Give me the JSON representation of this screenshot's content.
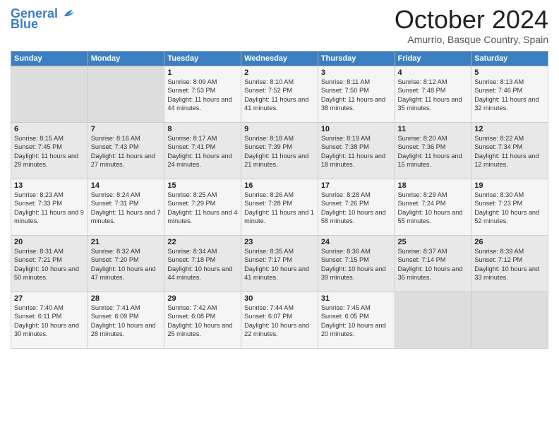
{
  "header": {
    "logo_line1": "General",
    "logo_line2": "Blue",
    "month": "October 2024",
    "location": "Amurrio, Basque Country, Spain"
  },
  "weekdays": [
    "Sunday",
    "Monday",
    "Tuesday",
    "Wednesday",
    "Thursday",
    "Friday",
    "Saturday"
  ],
  "weeks": [
    [
      {
        "day": "",
        "data": ""
      },
      {
        "day": "",
        "data": ""
      },
      {
        "day": "1",
        "data": "Sunrise: 8:09 AM\nSunset: 7:53 PM\nDaylight: 11 hours and 44 minutes."
      },
      {
        "day": "2",
        "data": "Sunrise: 8:10 AM\nSunset: 7:52 PM\nDaylight: 11 hours and 41 minutes."
      },
      {
        "day": "3",
        "data": "Sunrise: 8:11 AM\nSunset: 7:50 PM\nDaylight: 11 hours and 38 minutes."
      },
      {
        "day": "4",
        "data": "Sunrise: 8:12 AM\nSunset: 7:48 PM\nDaylight: 11 hours and 35 minutes."
      },
      {
        "day": "5",
        "data": "Sunrise: 8:13 AM\nSunset: 7:46 PM\nDaylight: 11 hours and 32 minutes."
      }
    ],
    [
      {
        "day": "6",
        "data": "Sunrise: 8:15 AM\nSunset: 7:45 PM\nDaylight: 11 hours and 29 minutes."
      },
      {
        "day": "7",
        "data": "Sunrise: 8:16 AM\nSunset: 7:43 PM\nDaylight: 11 hours and 27 minutes."
      },
      {
        "day": "8",
        "data": "Sunrise: 8:17 AM\nSunset: 7:41 PM\nDaylight: 11 hours and 24 minutes."
      },
      {
        "day": "9",
        "data": "Sunrise: 8:18 AM\nSunset: 7:39 PM\nDaylight: 11 hours and 21 minutes."
      },
      {
        "day": "10",
        "data": "Sunrise: 8:19 AM\nSunset: 7:38 PM\nDaylight: 11 hours and 18 minutes."
      },
      {
        "day": "11",
        "data": "Sunrise: 8:20 AM\nSunset: 7:36 PM\nDaylight: 11 hours and 15 minutes."
      },
      {
        "day": "12",
        "data": "Sunrise: 8:22 AM\nSunset: 7:34 PM\nDaylight: 11 hours and 12 minutes."
      }
    ],
    [
      {
        "day": "13",
        "data": "Sunrise: 8:23 AM\nSunset: 7:33 PM\nDaylight: 11 hours and 9 minutes."
      },
      {
        "day": "14",
        "data": "Sunrise: 8:24 AM\nSunset: 7:31 PM\nDaylight: 11 hours and 7 minutes."
      },
      {
        "day": "15",
        "data": "Sunrise: 8:25 AM\nSunset: 7:29 PM\nDaylight: 11 hours and 4 minutes."
      },
      {
        "day": "16",
        "data": "Sunrise: 8:26 AM\nSunset: 7:28 PM\nDaylight: 11 hours and 1 minute."
      },
      {
        "day": "17",
        "data": "Sunrise: 8:28 AM\nSunset: 7:26 PM\nDaylight: 10 hours and 58 minutes."
      },
      {
        "day": "18",
        "data": "Sunrise: 8:29 AM\nSunset: 7:24 PM\nDaylight: 10 hours and 55 minutes."
      },
      {
        "day": "19",
        "data": "Sunrise: 8:30 AM\nSunset: 7:23 PM\nDaylight: 10 hours and 52 minutes."
      }
    ],
    [
      {
        "day": "20",
        "data": "Sunrise: 8:31 AM\nSunset: 7:21 PM\nDaylight: 10 hours and 50 minutes."
      },
      {
        "day": "21",
        "data": "Sunrise: 8:32 AM\nSunset: 7:20 PM\nDaylight: 10 hours and 47 minutes."
      },
      {
        "day": "22",
        "data": "Sunrise: 8:34 AM\nSunset: 7:18 PM\nDaylight: 10 hours and 44 minutes."
      },
      {
        "day": "23",
        "data": "Sunrise: 8:35 AM\nSunset: 7:17 PM\nDaylight: 10 hours and 41 minutes."
      },
      {
        "day": "24",
        "data": "Sunrise: 8:36 AM\nSunset: 7:15 PM\nDaylight: 10 hours and 39 minutes."
      },
      {
        "day": "25",
        "data": "Sunrise: 8:37 AM\nSunset: 7:14 PM\nDaylight: 10 hours and 36 minutes."
      },
      {
        "day": "26",
        "data": "Sunrise: 8:39 AM\nSunset: 7:12 PM\nDaylight: 10 hours and 33 minutes."
      }
    ],
    [
      {
        "day": "27",
        "data": "Sunrise: 7:40 AM\nSunset: 6:11 PM\nDaylight: 10 hours and 30 minutes."
      },
      {
        "day": "28",
        "data": "Sunrise: 7:41 AM\nSunset: 6:09 PM\nDaylight: 10 hours and 28 minutes."
      },
      {
        "day": "29",
        "data": "Sunrise: 7:42 AM\nSunset: 6:08 PM\nDaylight: 10 hours and 25 minutes."
      },
      {
        "day": "30",
        "data": "Sunrise: 7:44 AM\nSunset: 6:07 PM\nDaylight: 10 hours and 22 minutes."
      },
      {
        "day": "31",
        "data": "Sunrise: 7:45 AM\nSunset: 6:05 PM\nDaylight: 10 hours and 20 minutes."
      },
      {
        "day": "",
        "data": ""
      },
      {
        "day": "",
        "data": ""
      }
    ]
  ]
}
